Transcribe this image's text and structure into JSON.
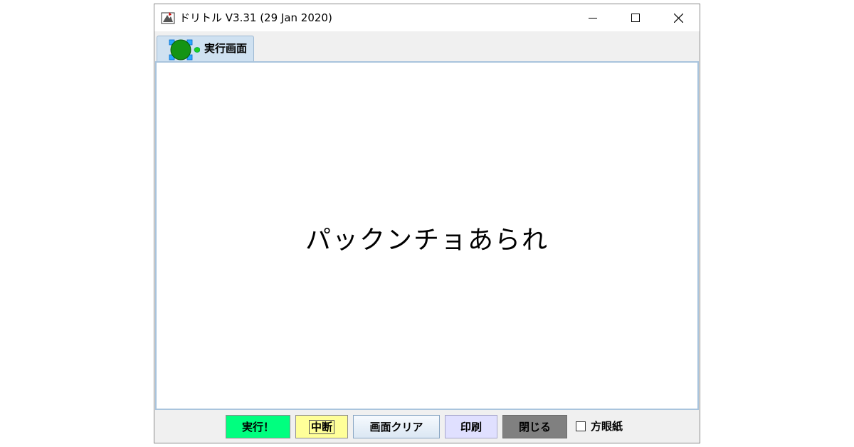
{
  "window": {
    "title": "ドリトル V3.31 (29 Jan 2020)",
    "icons": {
      "app": "dolittle-app-icon",
      "minimize": "minimize-icon",
      "maximize": "maximize-icon",
      "close": "close-icon"
    }
  },
  "tabs": [
    {
      "label": "実行画面",
      "icon": "turtle-icon",
      "selected": true
    }
  ],
  "canvas": {
    "text": "パックンチョあられ"
  },
  "toolbar": {
    "run_label": "実行！",
    "stop_label": "中断",
    "clear_label": "画面クリア",
    "print_label": "印刷",
    "close_label": "閉じる",
    "grid_label": "方眼紙",
    "grid_checked": false
  },
  "colors": {
    "run": "#00ff7f",
    "stop": "#ffff99",
    "print": "#e0e0ff",
    "close": "#808080",
    "tab": "#cfe1f1",
    "turtle": "#149414"
  }
}
